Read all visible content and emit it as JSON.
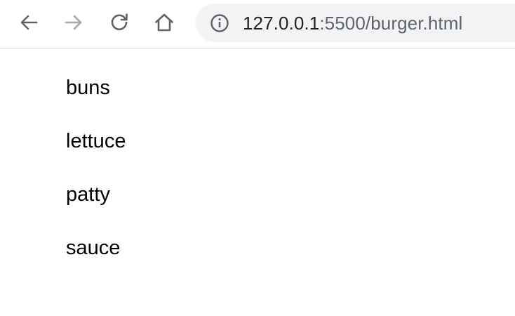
{
  "browser": {
    "url_host": "127.0.0.1",
    "url_rest": ":5500/burger.html"
  },
  "page": {
    "items": [
      "buns",
      "lettuce",
      "patty",
      "sauce"
    ]
  },
  "colors": {
    "icon_active": "#5f6368",
    "icon_disabled": "#a4a8ad",
    "omnibox_bg": "#f1f3f4"
  }
}
